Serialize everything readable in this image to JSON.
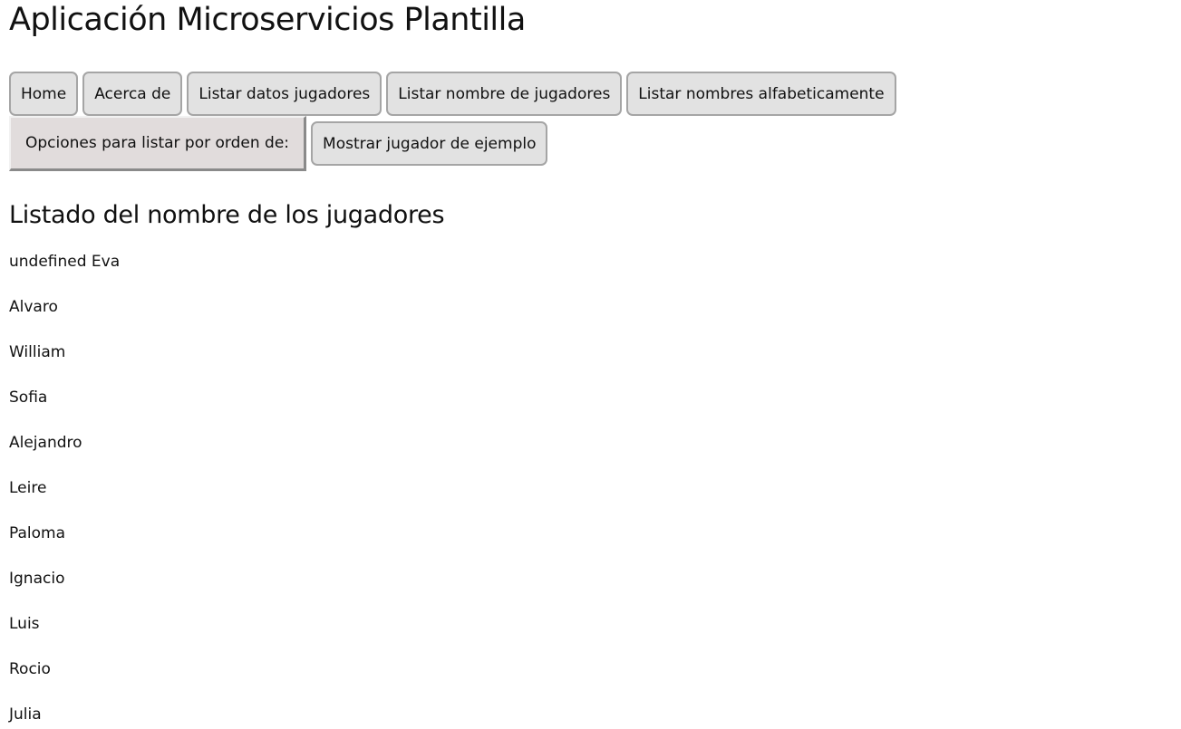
{
  "app": {
    "title": "Aplicación Microservicios Plantilla"
  },
  "nav": {
    "items": [
      {
        "label": "Home"
      },
      {
        "label": "Acerca de"
      },
      {
        "label": "Listar datos jugadores"
      },
      {
        "label": "Listar nombre de jugadores"
      },
      {
        "label": "Listar nombres alfabeticamente"
      },
      {
        "label": "Opciones para listar por orden de:"
      },
      {
        "label": "Mostrar jugador de ejemplo"
      }
    ]
  },
  "main": {
    "title": "Listado del nombre de los jugadores",
    "players": [
      "undefined Eva",
      "Alvaro",
      "William",
      "Sofia",
      "Alejandro",
      "Leire",
      "Paloma",
      "Ignacio",
      "Luis",
      "Rocio",
      "Julia"
    ]
  },
  "colors": {
    "button_background": "#e2e2e2",
    "button_border": "#a5a5a5",
    "dropdown_background": "#e1dcdc",
    "text": "#111111",
    "page_background": "#ffffff"
  }
}
